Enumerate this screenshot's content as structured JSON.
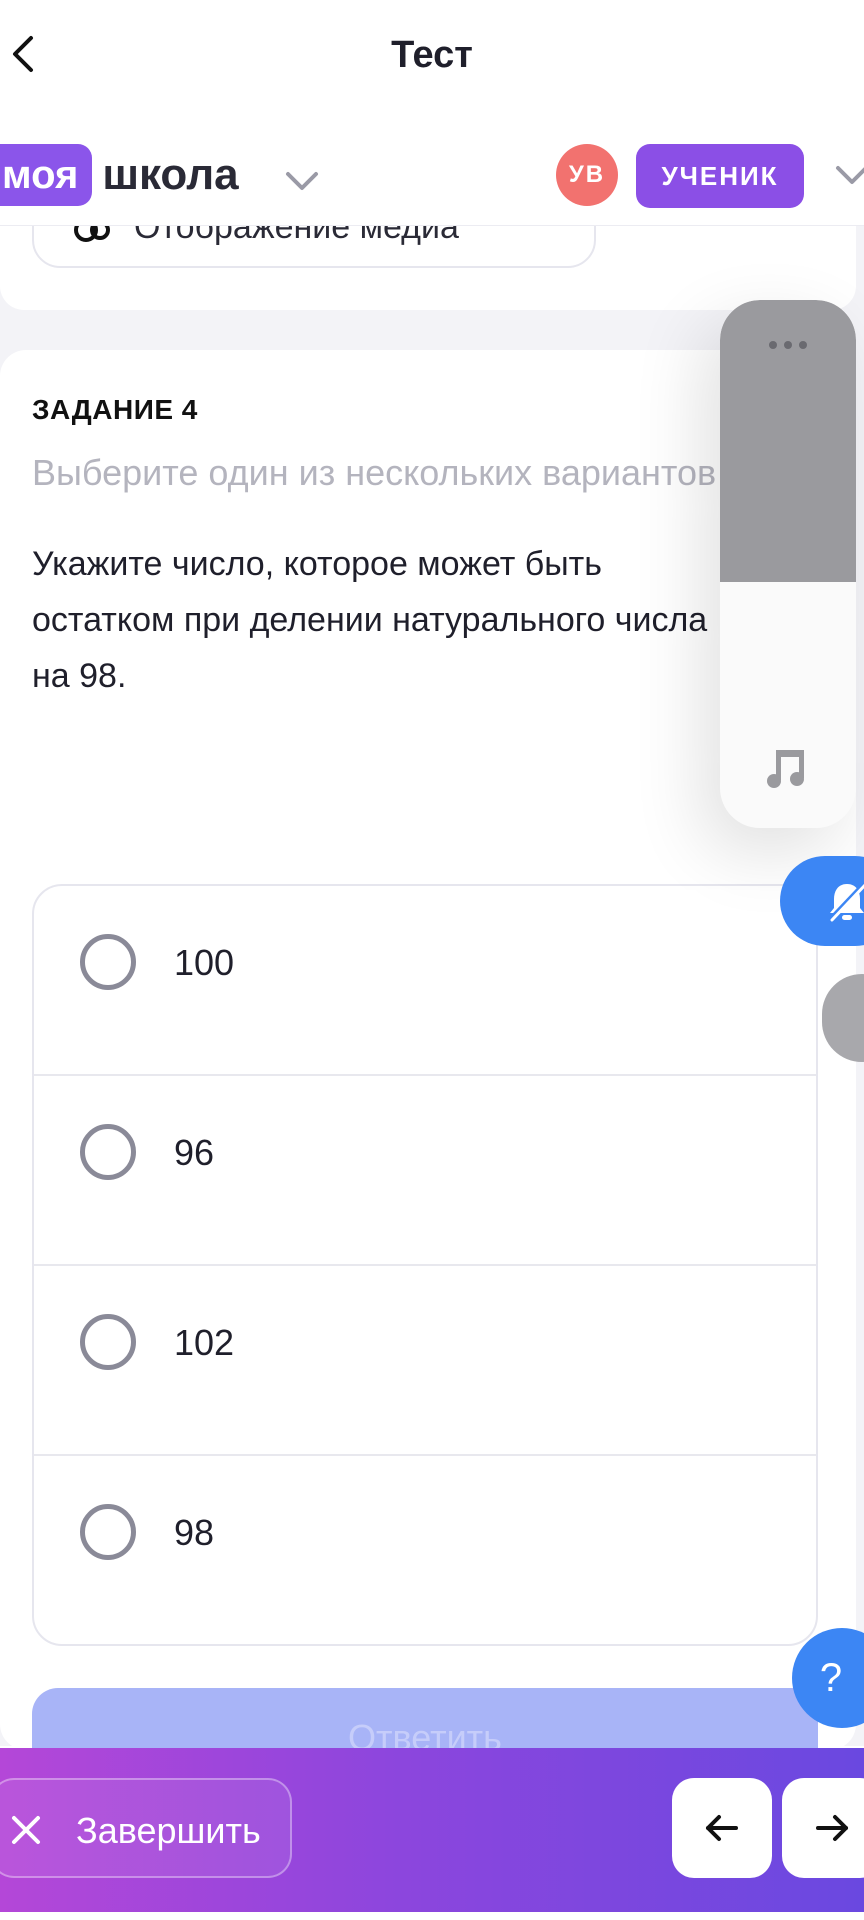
{
  "header": {
    "title": "Тест"
  },
  "school_header": {
    "logo_tag": "моя",
    "logo_word": "школа",
    "avatar_initials": "УВ",
    "role": "УЧЕНИК"
  },
  "media_toggle": {
    "label": "Отображение медиа"
  },
  "task": {
    "number": "ЗАДАНИЕ 4",
    "hint": "Выберите один из нескольких вариантов",
    "question": "Укажите число, которое может быть остатком при делении натурального числа на 98."
  },
  "options": [
    {
      "label": "100"
    },
    {
      "label": "96"
    },
    {
      "label": "102"
    },
    {
      "label": "98"
    }
  ],
  "submit": {
    "label": "Ответить"
  },
  "bottom_bar": {
    "finish_label": "Завершить"
  },
  "floating": {
    "help_label": "?"
  },
  "colors": {
    "accent_purple": "#8b55ea",
    "avatar_red": "#f2726f",
    "primary_blue": "#3c86f4",
    "submit_disabled": "#a8b4f7"
  },
  "icons": [
    "back-chevron-icon",
    "chevron-down-icon",
    "media-icon",
    "dots-icon",
    "music-note-icon",
    "bell-off-icon",
    "close-icon",
    "arrow-left-icon",
    "arrow-right-icon",
    "help-icon"
  ]
}
